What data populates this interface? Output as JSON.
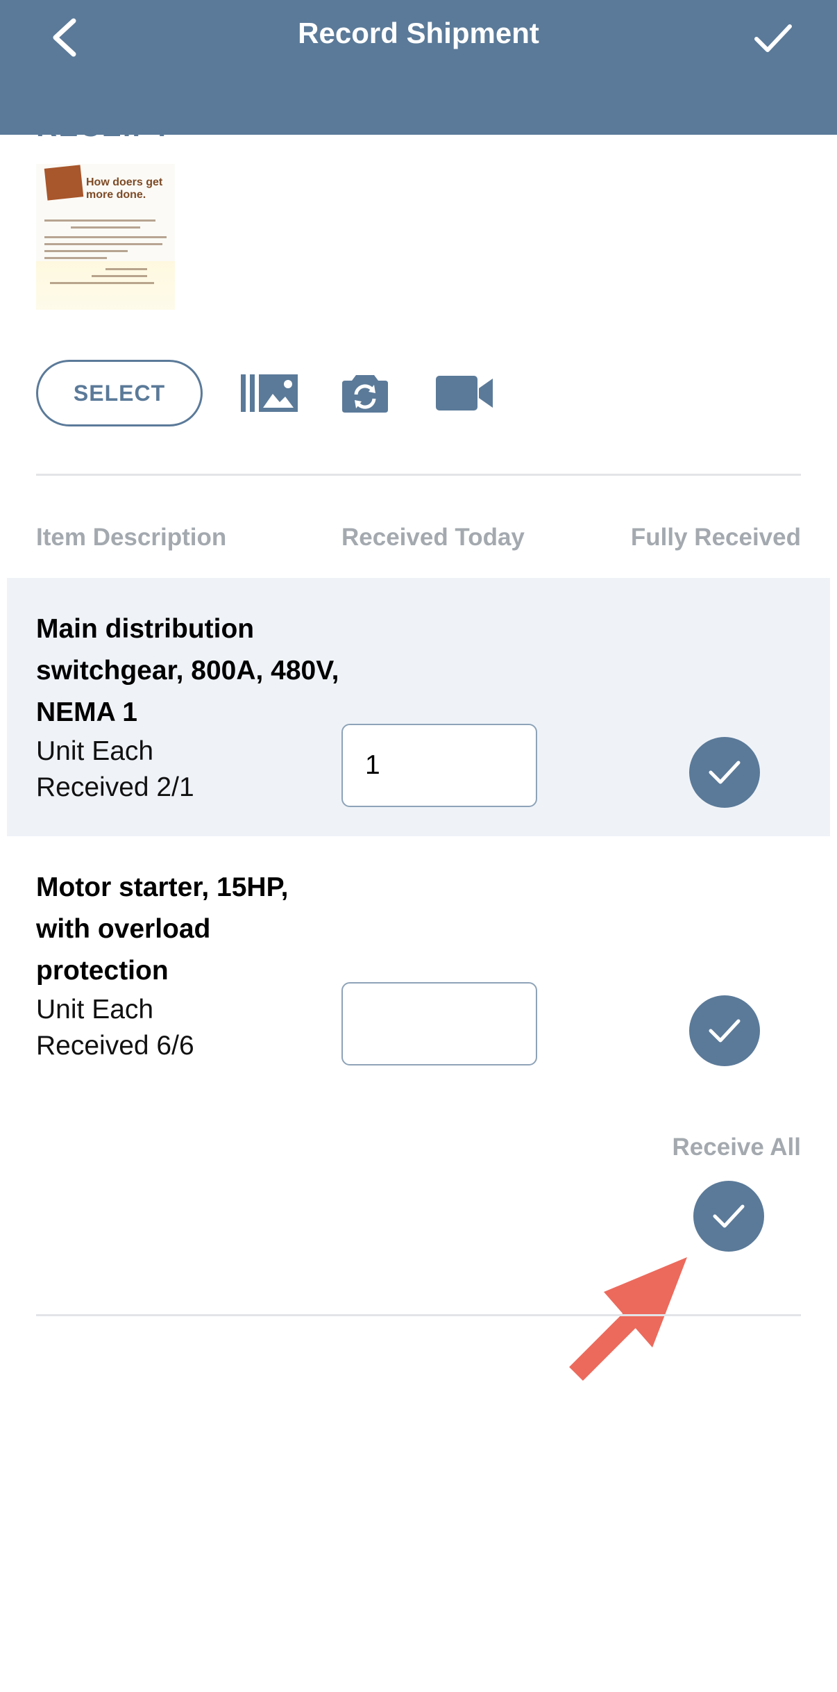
{
  "header": {
    "title": "Record Shipment",
    "back_icon": "chevron-left-icon",
    "confirm_icon": "checkmark-icon",
    "background": "#5b7a99"
  },
  "receipt": {
    "heading": "RECEIPT",
    "thumb_tagline": "How doers get more done."
  },
  "media": {
    "select_label": "SELECT",
    "icons": [
      "photo-library-icon",
      "camera-switch-icon",
      "video-camera-icon"
    ]
  },
  "table": {
    "headers": {
      "item": "Item Description",
      "received_today": "Received Today",
      "fully_received": "Fully Received"
    },
    "rows": [
      {
        "title": "Main distribution switchgear, 800A, 480V, NEMA 1",
        "unit": "Unit Each",
        "received": "Received 2/1",
        "qty": "1",
        "fully_received": true
      },
      {
        "title": "Motor starter, 15HP, with overload protection",
        "unit": "Unit Each",
        "received": "Received 6/6",
        "qty": "",
        "fully_received": true
      }
    ]
  },
  "receive_all": {
    "label": "Receive All",
    "checked": true
  },
  "colors": {
    "accent": "#5b7a99",
    "row_highlight": "#eff3f8",
    "muted_text": "#a3a9af",
    "annotation_arrow": "#ec6a5c"
  }
}
